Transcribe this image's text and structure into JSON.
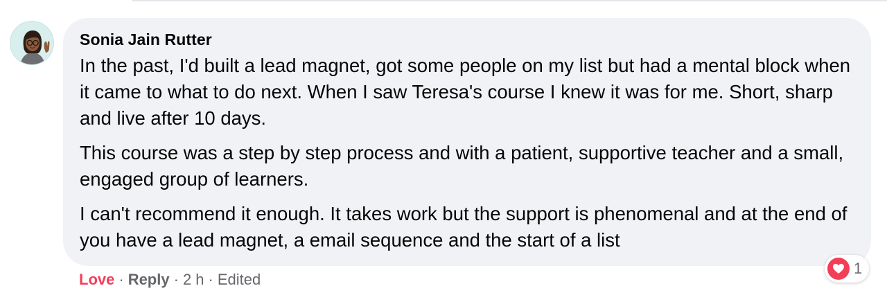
{
  "comment": {
    "author": "Sonia Jain Rutter",
    "paragraphs": [
      "In the past, I'd built a lead magnet, got some people on my list but had a mental block when it came to what to do next. When I saw Teresa's course I knew it was for me. Short, sharp and live after 10 days.",
      "This course was a step by step process and with a patient, supportive teacher and a small, engaged group of learners.",
      "I can't recommend it enough. It takes work but the support is phenomenal and at the end of you have a lead magnet, a email sequence and the start of a list"
    ],
    "reaction": {
      "icon": "heart-icon",
      "count": "1",
      "color": "#f33e58"
    }
  },
  "actions": {
    "love_label": "Love",
    "separator": "·",
    "reply_label": "Reply",
    "time": "2 h",
    "edited": "Edited"
  },
  "colors": {
    "bubble": "#f0f2f5",
    "text": "#050505",
    "meta": "#65676b",
    "love": "#f33e58"
  }
}
